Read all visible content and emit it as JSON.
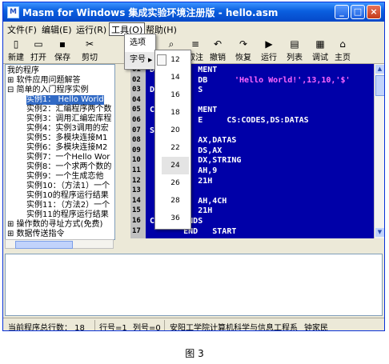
{
  "window": {
    "icon": "M",
    "title": "Masm for Windows 集成实验环境注册版 - hello.asm",
    "minimize": "_",
    "maximize": "□",
    "close": "×"
  },
  "menu": [
    "文件(F)",
    "编辑(E)",
    "运行(R)",
    "工具(O)",
    "帮助(H)"
  ],
  "toolbar": [
    {
      "icon": "new-file-icon",
      "glyph": "▯",
      "label": "新建"
    },
    {
      "icon": "open-folder-icon",
      "glyph": "▭",
      "label": "打开"
    },
    {
      "icon": "save-icon",
      "glyph": "▪",
      "label": "保存"
    },
    {
      "icon": "cut-icon",
      "glyph": "✂",
      "label": "剪切"
    },
    {
      "icon": "find-icon",
      "glyph": "⌕",
      "label": "释"
    },
    {
      "icon": "uncomment-icon",
      "glyph": "≡",
      "label": "取注"
    },
    {
      "icon": "undo-icon",
      "glyph": "↶",
      "label": "撤销"
    },
    {
      "icon": "redo-icon",
      "glyph": "↷",
      "label": "恢复"
    },
    {
      "icon": "run-icon",
      "glyph": "▶",
      "label": "运行"
    },
    {
      "icon": "list-icon",
      "glyph": "▤",
      "label": "列表"
    },
    {
      "icon": "debug-icon",
      "glyph": "▦",
      "label": "调试"
    },
    {
      "icon": "home-icon",
      "glyph": "⌂",
      "label": "主页"
    }
  ],
  "tree": [
    {
      "text": "我的程序",
      "indent": 0,
      "sel": false
    },
    {
      "text": "⊞ 软件应用问题解答",
      "indent": 0,
      "sel": false
    },
    {
      "text": "⊟ 简单的入门程序实例",
      "indent": 0,
      "sel": false
    },
    {
      "text": "实例1： Hello World",
      "indent": 2,
      "sel": true
    },
    {
      "text": "实例2：汇编程序两个数",
      "indent": 2,
      "sel": false
    },
    {
      "text": "实例3：调用汇编宏库程",
      "indent": 2,
      "sel": false
    },
    {
      "text": "实例4：实例3调用的宏",
      "indent": 2,
      "sel": false
    },
    {
      "text": "实例5：多模块连接M1",
      "indent": 2,
      "sel": false
    },
    {
      "text": "实例6：多模块连接M2",
      "indent": 2,
      "sel": false
    },
    {
      "text": "实例7：一个Hello Wor",
      "indent": 2,
      "sel": false
    },
    {
      "text": "实例8：一个求两个数的",
      "indent": 2,
      "sel": false
    },
    {
      "text": "实例9：一个生成恋他",
      "indent": 2,
      "sel": false
    },
    {
      "text": "实例10：（方法1）一个",
      "indent": 2,
      "sel": false
    },
    {
      "text": "实例10的程序运行结果",
      "indent": 2,
      "sel": false
    },
    {
      "text": "实例11：（方法2）一个",
      "indent": 2,
      "sel": false
    },
    {
      "text": "实例11的程序运行结果",
      "indent": 2,
      "sel": false
    },
    {
      "text": "⊞ 操作数的寻址方式(免费)",
      "indent": 0,
      "sel": false
    },
    {
      "text": "⊞ 数据传送指令",
      "indent": 0,
      "sel": false
    }
  ],
  "code": [
    {
      "ln": "01",
      "text": "DAT       MENT"
    },
    {
      "ln": "02",
      "text": "          DB  ",
      "str": "'Hello World!',13,10,'$'"
    },
    {
      "ln": "03",
      "text": "DA        S"
    },
    {
      "ln": "04",
      "text": ""
    },
    {
      "ln": "05",
      "text": "CO        MENT"
    },
    {
      "ln": "06",
      "text": "          E     CS:CODES,DS:DATAS"
    },
    {
      "ln": "07",
      "text": "ST"
    },
    {
      "ln": "08",
      "text": "          AX,DATAS"
    },
    {
      "ln": "09",
      "text": "          DS,AX"
    },
    {
      "ln": "10",
      "text": "          DX,STRING"
    },
    {
      "ln": "11",
      "text": "          AH,9"
    },
    {
      "ln": "12",
      "text": "          21H"
    },
    {
      "ln": "13",
      "text": ""
    },
    {
      "ln": "14",
      "text": "          AH,4CH"
    },
    {
      "ln": "15",
      "text": "          21H"
    },
    {
      "ln": "16",
      "text": "CODES  ENDS"
    },
    {
      "ln": "17",
      "text": "       END   START"
    }
  ],
  "tools_menu": [
    "选项",
    "字号"
  ],
  "font_sizes": [
    "12",
    "14",
    "16",
    "18",
    "20",
    "22",
    "24",
    "26",
    "28",
    "36"
  ],
  "status": {
    "lines": "当前程序总行数： 18",
    "row": "行号=1",
    "col": "列号=0",
    "org": "安阳工学院计算机科学与信息工程系",
    "author": "钟家民"
  },
  "caption": "图 3",
  "colors": {
    "editor_bg": "#0000a8",
    "selection": "#316ac5",
    "titlebar": "#0a5fdf"
  }
}
